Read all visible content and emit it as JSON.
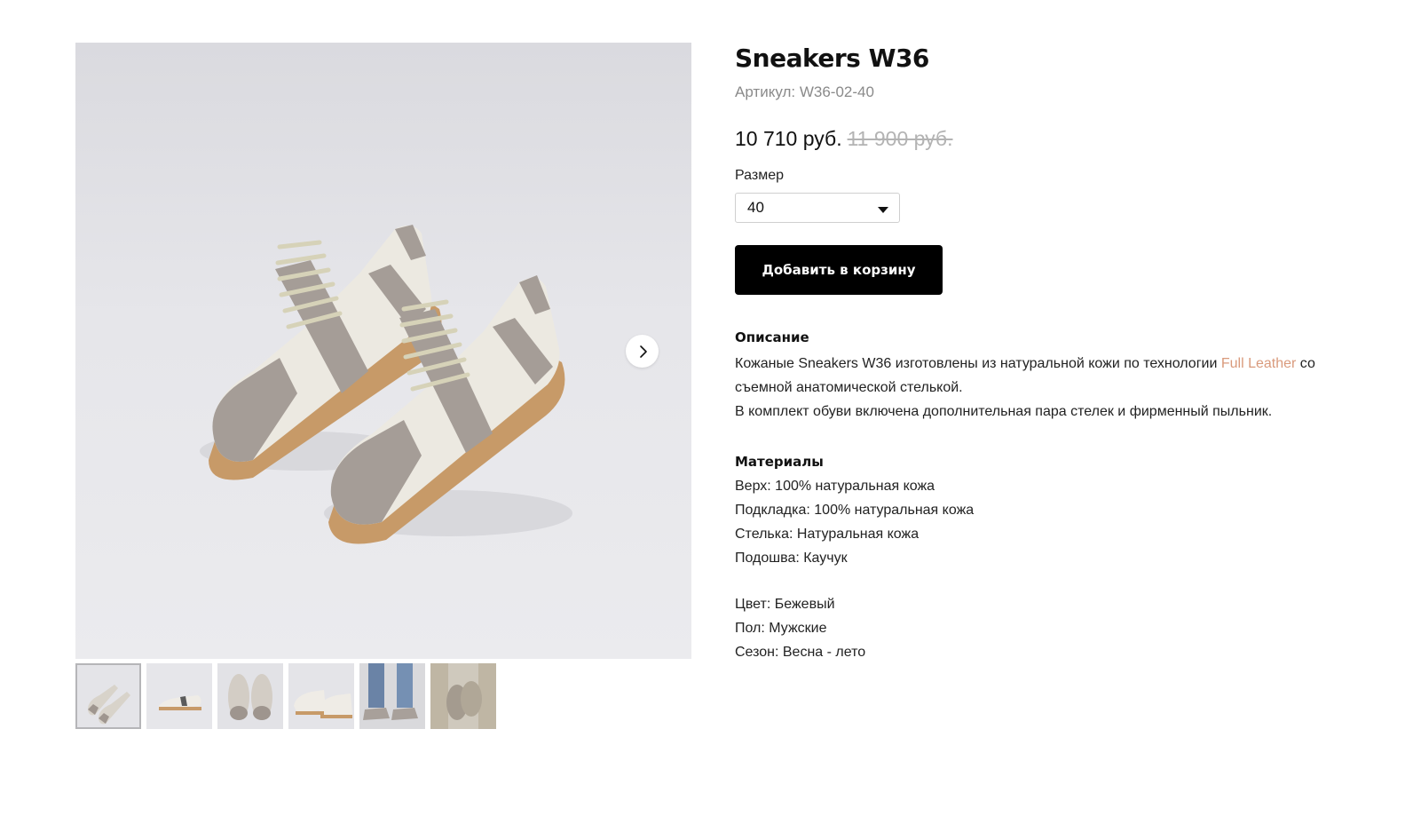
{
  "gallery": {
    "thumbnails": [
      {
        "name": "thumb-1",
        "active": true
      },
      {
        "name": "thumb-2",
        "active": false
      },
      {
        "name": "thumb-3",
        "active": false
      },
      {
        "name": "thumb-4",
        "active": false
      },
      {
        "name": "thumb-5",
        "active": false
      },
      {
        "name": "thumb-6",
        "active": false
      }
    ],
    "next_icon": "chevron-right-icon"
  },
  "product": {
    "title": "Sneakers W36",
    "sku": "Артикул: W36-02-40",
    "price_current": "10 710 руб.",
    "price_old": "11 900 руб.",
    "size_label": "Размер",
    "size_value": "40",
    "add_to_cart": "Добавить в корзину"
  },
  "description": {
    "title": "Описание",
    "text_before_link": "Кожаные Sneakers W36 изготовлены из натуральной кожи по технологии ",
    "link": "Full Leather",
    "text_after_link": " со съемной анатомической стелькой.",
    "text_line2": "В комплект обуви включена дополнительная пара стелек и фирменный пыльник."
  },
  "materials": {
    "title": "Материалы",
    "lines": [
      "Верх: 100% натуральная кожа",
      "Подкладка: 100% натуральная кожа",
      "Стелька: Натуральная кожа",
      "Подошва: Каучук"
    ]
  },
  "attributes": {
    "lines": [
      "Цвет: Бежевый",
      "Пол: Мужские",
      "Сезон: Весна - лето"
    ]
  },
  "colors": {
    "accent_link": "#d99a7c",
    "button_bg": "#000000",
    "old_price": "#b3b3b3"
  }
}
